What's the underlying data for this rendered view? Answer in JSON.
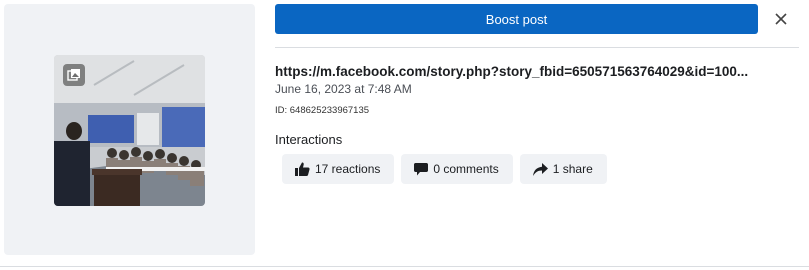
{
  "post": {
    "link": "https://m.facebook.com/story.php?story_fbid=650571563764029&id=100...",
    "date": "June 16, 2023 at 7:48 AM",
    "id_label": "ID: 648625233967135"
  },
  "actions": {
    "boost_label": "Boost post"
  },
  "interactions": {
    "heading": "Interactions",
    "reactions_label": "17 reactions",
    "comments_label": "0 comments",
    "shares_label": "1 share"
  },
  "colors": {
    "accent": "#0a66c2",
    "panel_bg": "#f0f2f5",
    "chip_bg": "#f0f2f5"
  },
  "icons": {
    "badge": "photo-album-icon",
    "close": "close-icon",
    "reactions": "thumbs-up-icon",
    "comments": "comment-bubble-icon",
    "shares": "share-arrow-icon"
  }
}
